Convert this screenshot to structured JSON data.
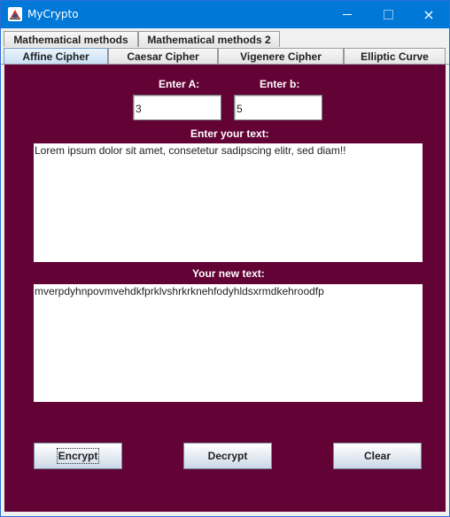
{
  "window": {
    "title": "MyCrypto",
    "icon": "mycrypto-app-icon",
    "controls": {
      "minimize": "minimize-icon",
      "maximize": "maximize-icon",
      "close": "×"
    }
  },
  "tabs": {
    "row1": [
      {
        "label": "Mathematical methods"
      },
      {
        "label": "Mathematical methods 2"
      }
    ],
    "row2": [
      {
        "label": "Affine Cipher",
        "selected": true
      },
      {
        "label": "Caesar Cipher"
      },
      {
        "label": "Vigenere Cipher"
      },
      {
        "label": "Elliptic Curve"
      }
    ]
  },
  "affine": {
    "a_label": "Enter A:",
    "a_value": "3",
    "b_label": "Enter b:",
    "b_value": "5",
    "input_label": "Enter your text:",
    "input_text": "Lorem ipsum dolor sit amet, consetetur sadipscing elitr, sed diam!!",
    "output_label": "Your new text:",
    "output_text": "mverpdyhnpovmvehdkfprklvshrkrknehfodyhldsxrmdkehroodfp"
  },
  "buttons": {
    "encrypt": "Encrypt",
    "decrypt": "Decrypt",
    "clear": "Clear"
  },
  "colors": {
    "panel_background": "#630235",
    "titlebar": "#0078d7",
    "label_text": "#ffffff"
  }
}
